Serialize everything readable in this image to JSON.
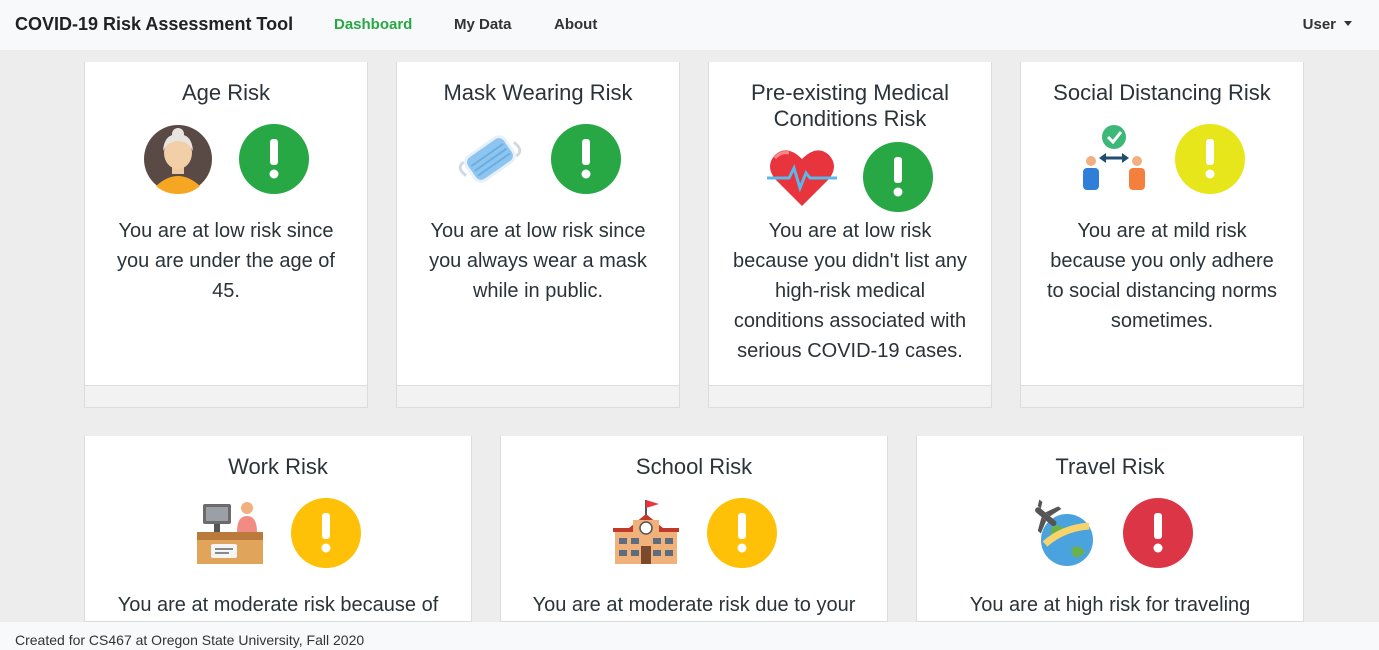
{
  "navbar": {
    "brand": "COVID-19 Risk Assessment Tool",
    "links": [
      "Dashboard",
      "My Data",
      "About"
    ],
    "active": "Dashboard",
    "user": "User"
  },
  "colors": {
    "low": "#28a745",
    "mild": "#e6e61a",
    "moderate": "#ffc107",
    "high": "#dc3545",
    "active_nav": "#28a745"
  },
  "cards": [
    {
      "title": "Age Risk",
      "icon": "elderly-woman-avatar-icon",
      "level": "low",
      "text": "You are at low risk since you are under the age of 45."
    },
    {
      "title": "Mask Wearing Risk",
      "icon": "face-mask-icon",
      "level": "low",
      "text": "You are at low risk since you always wear a mask while in public."
    },
    {
      "title": "Pre-existing Medical Conditions Risk",
      "icon": "heart-pulse-icon",
      "level": "low",
      "text": "You are at low risk because you didn't list any high-risk medical conditions associated with serious COVID-19 cases."
    },
    {
      "title": "Social Distancing Risk",
      "icon": "social-distancing-icon",
      "level": "mild",
      "text": "You are at mild risk because you only adhere to social distancing norms sometimes."
    },
    {
      "title": "Work Risk",
      "icon": "work-desk-icon",
      "level": "moderate",
      "text": "You are at moderate risk because of"
    },
    {
      "title": "School Risk",
      "icon": "school-building-icon",
      "level": "moderate",
      "text": "You are at moderate risk due to your"
    },
    {
      "title": "Travel Risk",
      "icon": "airplane-globe-icon",
      "level": "high",
      "text": "You are at high risk for traveling"
    }
  ],
  "footer": {
    "text": "Created for CS467 at Oregon State University, Fall 2020"
  }
}
